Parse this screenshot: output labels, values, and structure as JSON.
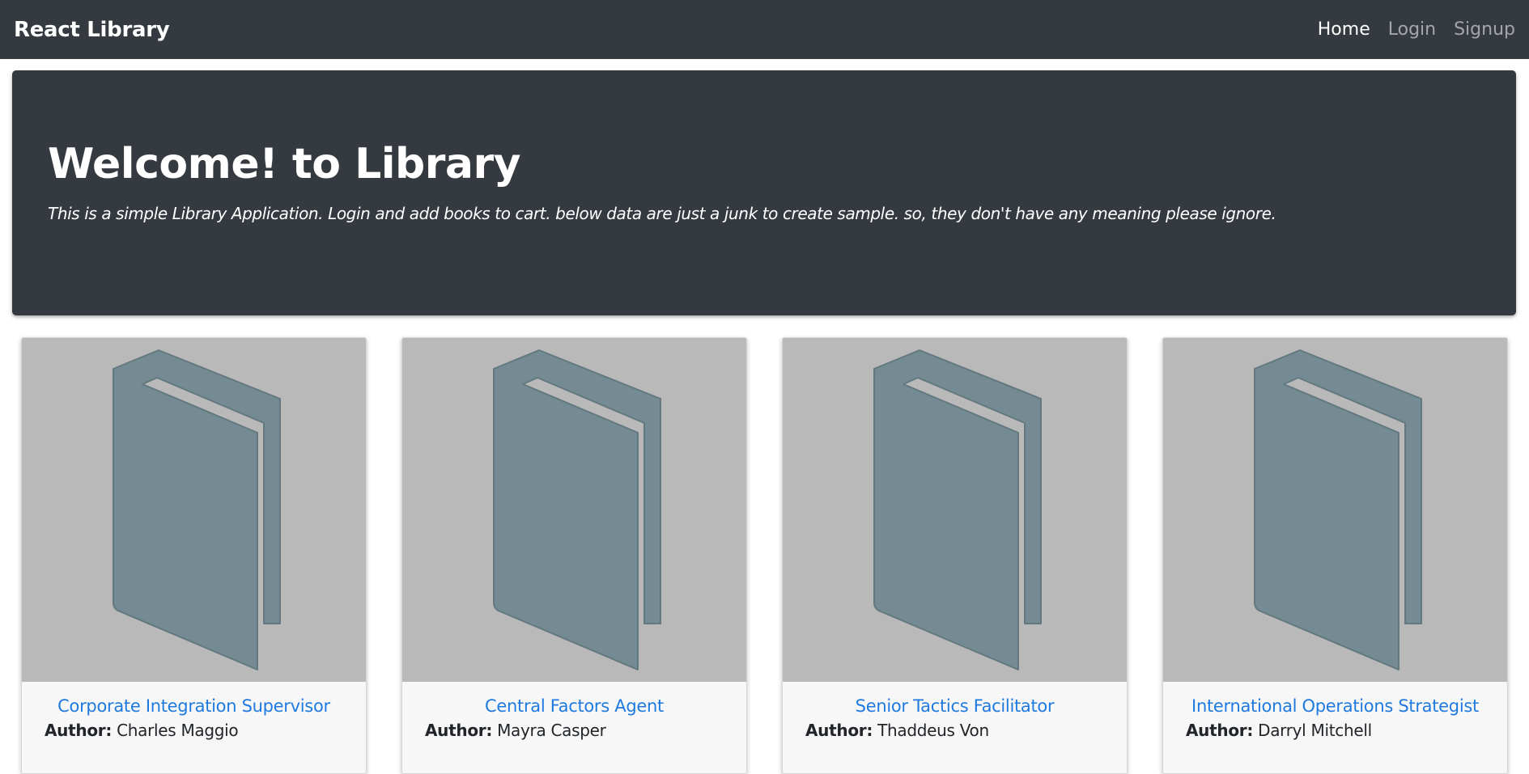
{
  "navbar": {
    "brand": "React Library",
    "links": [
      {
        "label": "Home"
      },
      {
        "label": "Login"
      },
      {
        "label": "Signup"
      }
    ]
  },
  "hero": {
    "title": "Welcome! to Library",
    "subtitle": "This is a simple Library Application. Login and add books to cart. below data are just a junk to create sample. so, they don't have any meaning please ignore."
  },
  "author_label": "Author:",
  "books": [
    {
      "title": "Corporate Integration Supervisor",
      "author": "Charles Maggio",
      "icon": "book-icon"
    },
    {
      "title": "Central Factors Agent",
      "author": "Mayra Casper",
      "icon": "book-icon"
    },
    {
      "title": "Senior Tactics Facilitator",
      "author": "Thaddeus Von",
      "icon": "book-icon"
    },
    {
      "title": "International Operations Strategist",
      "author": "Darryl Mitchell",
      "icon": "book-icon"
    }
  ],
  "colors": {
    "navbar_bg": "#343a40",
    "link_blue": "#1f7ae0",
    "placeholder_bg": "#b9b9b9",
    "book_fill": "#748b94"
  }
}
